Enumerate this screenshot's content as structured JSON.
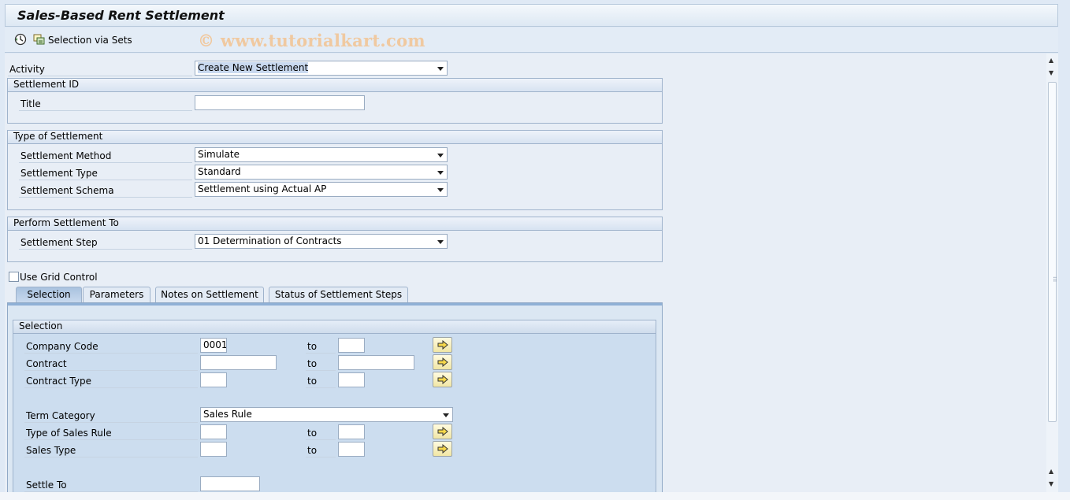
{
  "window": {
    "title": "Sales-Based Rent Settlement"
  },
  "toolbar": {
    "selection_sets_label": "Selection via Sets",
    "watermark": "© www.tutorialkart.com"
  },
  "activity": {
    "label": "Activity",
    "value": "Create New Settlement"
  },
  "settlement_id": {
    "header": "Settlement ID",
    "title_label": "Title",
    "title_value": ""
  },
  "type_of_settlement": {
    "header": "Type of Settlement",
    "method_label": "Settlement Method",
    "method_value": "Simulate",
    "type_label": "Settlement Type",
    "type_value": "Standard",
    "schema_label": "Settlement Schema",
    "schema_value": "Settlement using Actual AP"
  },
  "perform_settlement": {
    "header": "Perform Settlement To",
    "step_label": "Settlement Step",
    "step_value": "01 Determination of Contracts"
  },
  "grid_control": {
    "label": "Use Grid Control",
    "checked": false
  },
  "tabs": [
    {
      "label": "Selection",
      "active": true
    },
    {
      "label": "Parameters",
      "active": false
    },
    {
      "label": "Notes on Settlement",
      "active": false
    },
    {
      "label": "Status of Settlement Steps",
      "active": false
    }
  ],
  "selection": {
    "header": "Selection",
    "to_label": "to",
    "company_code_label": "Company Code",
    "company_code_from": "0001",
    "company_code_to": "",
    "contract_label": "Contract",
    "contract_from": "",
    "contract_to": "",
    "contract_type_label": "Contract Type",
    "contract_type_from": "",
    "contract_type_to": "",
    "term_category_label": "Term Category",
    "term_category_value": "Sales Rule",
    "sales_rule_type_label": "Type of Sales Rule",
    "sales_rule_type_from": "",
    "sales_rule_type_to": "",
    "sales_type_label": "Sales Type",
    "sales_type_from": "",
    "sales_type_to": "",
    "settle_to_label": "Settle To",
    "settle_to_value": ""
  },
  "colors": {
    "background": "#dfe9f5",
    "group_header": "#d7e3f1",
    "active_tab": "#a9c2df",
    "multi_select_button": "#f1e6a4"
  }
}
